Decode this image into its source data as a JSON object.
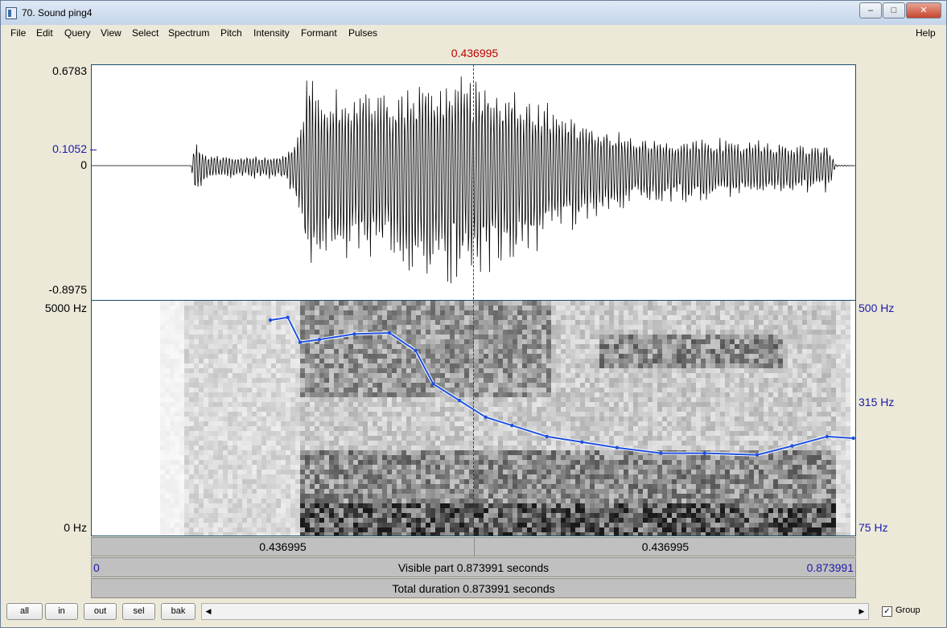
{
  "window": {
    "title": "70. Sound ping4"
  },
  "menu": [
    "File",
    "Edit",
    "Query",
    "View",
    "Select",
    "Spectrum",
    "Pitch",
    "Intensity",
    "Formant",
    "Pulses"
  ],
  "menu_help": "Help",
  "cursor_time": "0.436995",
  "waveform": {
    "y_max": "0.6783",
    "y_mid_value": "0.1052",
    "y_zero": "0",
    "y_min": "-0.8975"
  },
  "spectrogram": {
    "freq_top": "5000 Hz",
    "freq_bottom": "0 Hz"
  },
  "pitch_axis": {
    "top": "500 Hz",
    "mid": "315 Hz",
    "bottom": "75 Hz"
  },
  "time_bar": {
    "left": "0.436995",
    "right": "0.436995"
  },
  "visible_bar": {
    "start": "0",
    "label": "Visible part 0.873991 seconds",
    "end": "0.873991"
  },
  "total_bar": {
    "label": "Total duration 0.873991 seconds"
  },
  "buttons": {
    "all": "all",
    "in": "in",
    "out": "out",
    "sel": "sel",
    "bak": "bak"
  },
  "group": {
    "label": "Group",
    "checked": true
  },
  "colors": {
    "cursor": "#c00000",
    "axis_blue": "#1a1aaa",
    "pitch": "#1e50dc"
  },
  "chart_data": {
    "type": "line",
    "series": [
      {
        "x": [
          0.204,
          0.224,
          0.238,
          0.26,
          0.3,
          0.34,
          0.37,
          0.39,
          0.42,
          0.45,
          0.48,
          0.52,
          0.56,
          0.6,
          0.65,
          0.7,
          0.76,
          0.8,
          0.84,
          0.87
        ],
        "y": [
          465,
          470,
          425,
          430,
          440,
          442,
          410,
          350,
          320,
          290,
          275,
          255,
          245,
          235,
          225,
          225,
          222,
          238,
          255,
          252
        ]
      }
    ],
    "xlim": [
      0,
      0.873991
    ],
    "ylim": [
      75,
      500
    ]
  }
}
